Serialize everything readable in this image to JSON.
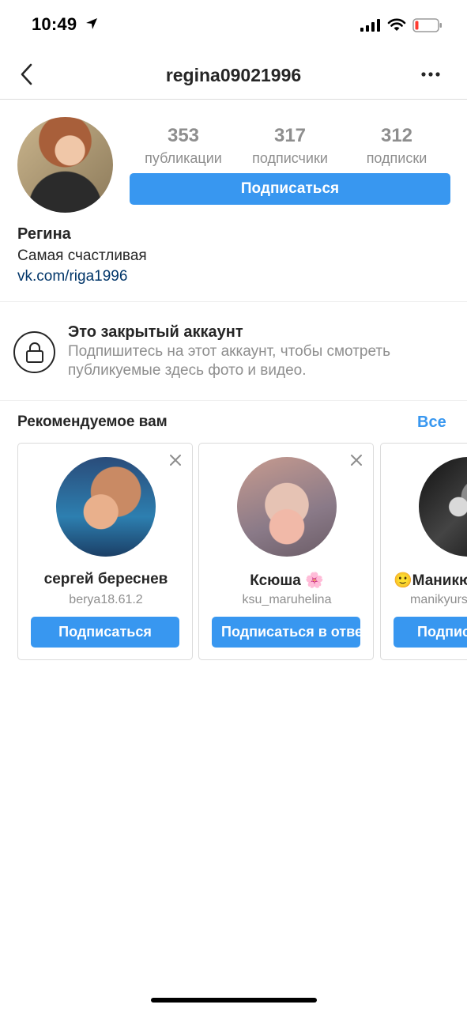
{
  "status_bar": {
    "time": "10:49"
  },
  "header": {
    "title": "regina09021996"
  },
  "profile": {
    "stats": [
      {
        "value": "353",
        "label": "публикации"
      },
      {
        "value": "317",
        "label": "подписчики"
      },
      {
        "value": "312",
        "label": "подписки"
      }
    ],
    "follow_label": "Подписаться",
    "name": "Регина",
    "bio": "Самая счастливая",
    "link": "vk.com/riga1996"
  },
  "private": {
    "title": "Это закрытый аккаунт",
    "text": "Подпишитесь на этот аккаунт, чтобы смотреть публикуемые здесь фото и видео."
  },
  "suggestions": {
    "title": "Рекомендуемое вам",
    "see_all": "Все",
    "cards": [
      {
        "name": "сергей береснев",
        "username": "berya18.61.2",
        "button": "Подписаться"
      },
      {
        "name": "Ксюша 🌸",
        "username": "ksu_maruhelina",
        "button": "Подписаться в ответ"
      },
      {
        "name": "🙂Маникюр",
        "username": "manikyurshop",
        "button": "Подписаться"
      }
    ]
  },
  "colors": {
    "accent": "#3897f0",
    "link": "#003569",
    "muted": "#8e8e8e",
    "text": "#262626"
  }
}
